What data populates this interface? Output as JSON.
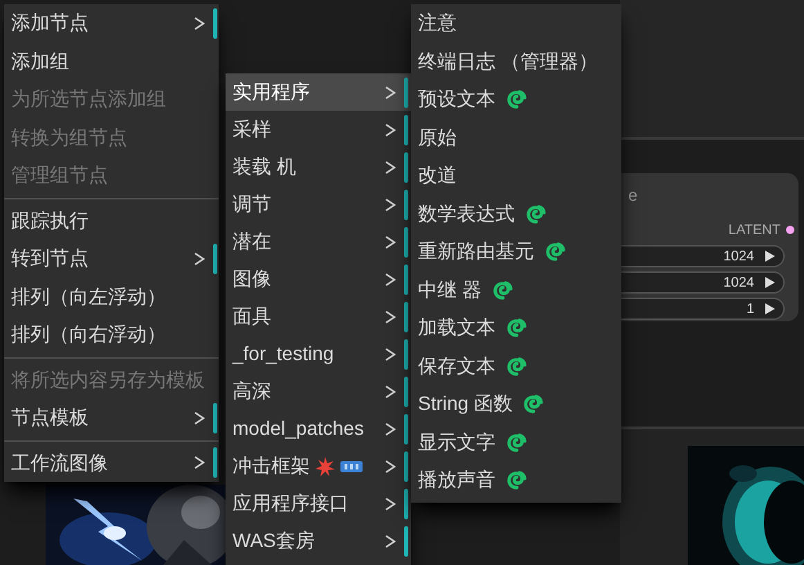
{
  "context_menu": {
    "items": [
      {
        "label": "添加节点",
        "kind": "submenu",
        "disabled": false
      },
      {
        "label": "添加组",
        "kind": "action",
        "disabled": false
      },
      {
        "label": "为所选节点添加组",
        "kind": "action",
        "disabled": true
      },
      {
        "label": "转换为组节点",
        "kind": "action",
        "disabled": true
      },
      {
        "label": "管理组节点",
        "kind": "action",
        "disabled": true
      },
      {
        "kind": "separator"
      },
      {
        "label": "跟踪执行",
        "kind": "action",
        "disabled": false
      },
      {
        "label": "转到节点",
        "kind": "submenu",
        "disabled": false
      },
      {
        "label": "排列（向左浮动）",
        "kind": "action",
        "disabled": false
      },
      {
        "label": "排列（向右浮动）",
        "kind": "action",
        "disabled": false
      },
      {
        "kind": "separator"
      },
      {
        "label": "将所选内容另存为模板",
        "kind": "action",
        "disabled": true
      },
      {
        "label": "节点模板",
        "kind": "submenu",
        "disabled": false
      },
      {
        "kind": "separator"
      },
      {
        "label": "工作流图像",
        "kind": "submenu",
        "disabled": false
      }
    ]
  },
  "category_menu": {
    "items": [
      {
        "label": "实用程序",
        "selected": true,
        "extras": false
      },
      {
        "label": "采样",
        "selected": false,
        "extras": false
      },
      {
        "label": "装载 机",
        "selected": false,
        "extras": false
      },
      {
        "label": "调节",
        "selected": false,
        "extras": false
      },
      {
        "label": "潜在",
        "selected": false,
        "extras": false
      },
      {
        "label": "图像",
        "selected": false,
        "extras": false
      },
      {
        "label": "面具",
        "selected": false,
        "extras": false
      },
      {
        "label": "_for_testing",
        "selected": false,
        "extras": false
      },
      {
        "label": "高深",
        "selected": false,
        "extras": false
      },
      {
        "label": "model_patches",
        "selected": false,
        "extras": false
      },
      {
        "label": "冲击框架",
        "selected": false,
        "extras": true
      },
      {
        "label": "应用程序接口",
        "selected": false,
        "extras": false
      },
      {
        "label": "WAS套房",
        "selected": false,
        "extras": false
      }
    ]
  },
  "node_menu": {
    "items": [
      {
        "label": "注意",
        "custom": false
      },
      {
        "label": "终端日志 （管理器）",
        "custom": false
      },
      {
        "label": "预设文本",
        "custom": true
      },
      {
        "label": "原始",
        "custom": false
      },
      {
        "label": "改道",
        "custom": false
      },
      {
        "label": "数学表达式",
        "custom": true
      },
      {
        "label": "重新路由基元",
        "custom": true
      },
      {
        "label": "中继 器",
        "custom": true
      },
      {
        "label": "加载文本",
        "custom": true
      },
      {
        "label": "保存文本",
        "custom": true
      },
      {
        "label": "String 函数",
        "custom": true
      },
      {
        "label": "显示文字",
        "custom": true
      },
      {
        "label": "播放声音",
        "custom": true
      }
    ]
  },
  "node": {
    "title": "e",
    "output": "LATENT",
    "widgets": [
      {
        "value": "1024"
      },
      {
        "value": "1024"
      },
      {
        "value": "1"
      }
    ]
  }
}
